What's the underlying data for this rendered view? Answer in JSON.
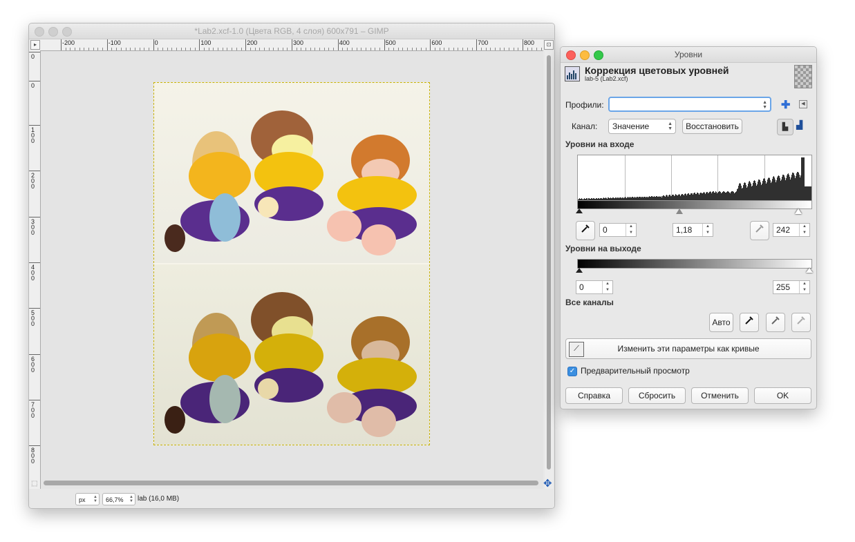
{
  "gimp_window": {
    "title": "*Lab2.xcf-1.0 (Цвета RGB, 4 слоя) 600x791 – GIMP",
    "ruler_top_labels": [
      "-200",
      "-100",
      "0",
      "100",
      "200",
      "300",
      "400",
      "500",
      "600",
      "700",
      "800"
    ],
    "ruler_left_labels": [
      "0",
      "0",
      "1 0 0",
      "2 0 0",
      "3 0 0",
      "4 0 0",
      "5 0 0",
      "6 0 0",
      "7 0 0",
      "8 0 0"
    ],
    "status": {
      "unit": "px",
      "zoom": "66,7%",
      "layer_info": "lab (16,0 MB)"
    }
  },
  "levels_dialog": {
    "window_title": "Уровни",
    "header_title": "Коррекция цветовых уровней",
    "header_subtitle": "lab-5 (Lab2.xcf)",
    "presets_label": "Профили:",
    "presets_value": "",
    "channel_label": "Канал:",
    "channel_value": "Значение",
    "reset_channel": "Восстановить",
    "input_levels_title": "Уровни на входе",
    "input_black": "0",
    "input_gamma": "1,18",
    "input_white": "242",
    "output_levels_title": "Уровни на выходе",
    "output_black": "0",
    "output_white": "255",
    "all_channels_title": "Все каналы",
    "auto_button": "Авто",
    "curves_button": "Изменить эти параметры как кривые",
    "preview_label": "Предварительный просмотр",
    "preview_checked": true,
    "buttons": {
      "help": "Справка",
      "reset": "Сбросить",
      "cancel": "Отменить",
      "ok": "OK"
    }
  },
  "icons": [
    "window-close-icon",
    "window-minimize-icon",
    "window-zoom-icon",
    "levels-icon",
    "layer-thumbnail-icon",
    "add-preset-icon",
    "preset-menu-icon",
    "linear-histogram-icon",
    "log-histogram-icon",
    "eyedropper-black-icon",
    "eyedropper-gray-icon",
    "eyedropper-white-icon",
    "curves-icon",
    "checkmark-icon",
    "navigate-icon",
    "quick-mask-icon"
  ],
  "colors": {
    "close": "#fc605b",
    "minimize": "#fdbc40",
    "zoom": "#34c84a",
    "accent": "#3b8fe0",
    "selection_border": "#c8b200"
  }
}
